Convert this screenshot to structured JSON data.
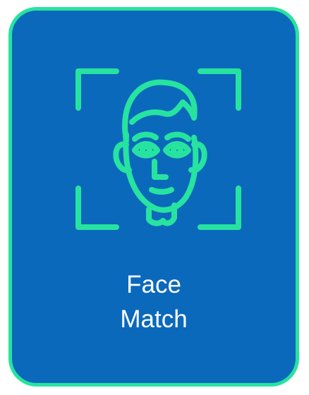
{
  "card": {
    "label_line1": "Face",
    "label_line2": "Match",
    "icon": "face-scan-icon",
    "colors": {
      "background": "#0a69bb",
      "accent": "#27e3a0",
      "text": "#ffffff"
    }
  }
}
